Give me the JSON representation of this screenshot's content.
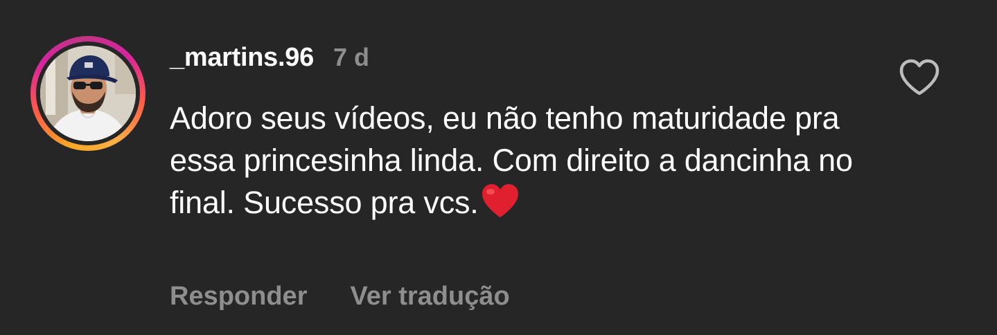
{
  "comment": {
    "username": "_martins.96",
    "time": "7 d",
    "text": "Adoro seus vídeos, eu não tenho maturidade pra essa princesinha linda. Com direito a dancinha no final. Sucesso pra vcs.",
    "text_emoji": "heart-emoji",
    "reply_label": "Responder",
    "translate_label": "Ver tradução",
    "like_icon": "heart-outline-icon",
    "avatar_ring": "story-ring",
    "colors": {
      "background": "#262626",
      "text": "#ffffff",
      "muted": "#8e8e8e",
      "emoji_heart": "#e0202e"
    }
  }
}
